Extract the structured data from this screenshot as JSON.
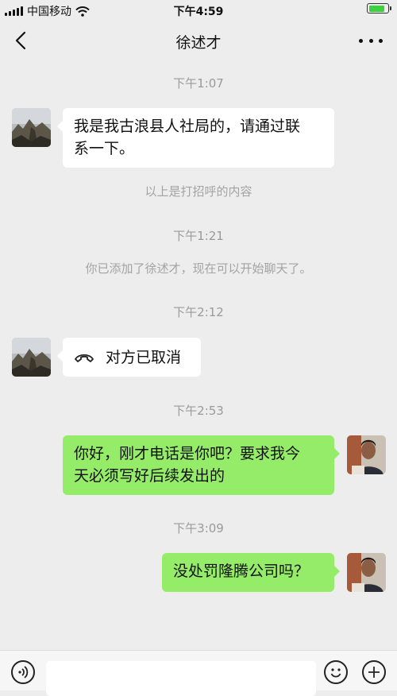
{
  "status_bar": {
    "carrier": "中国移动",
    "time": "下午4:59",
    "battery_level": 0.85
  },
  "header": {
    "title": "徐述才"
  },
  "messages": [
    {
      "time": "下午1:07"
    },
    {
      "from": "contact",
      "lines": [
        "我是我古浪县人社局的，请通过联",
        "系一下。"
      ]
    },
    {
      "system": "以上是打招呼的内容"
    },
    {
      "time": "下午1:21"
    },
    {
      "system": "你已添加了徐述才，现在可以开始聊天了。"
    },
    {
      "time": "下午2:12"
    },
    {
      "from": "contact",
      "call_status": "对方已取消",
      "icon": "phone-hangup-icon"
    },
    {
      "time": "下午2:53"
    },
    {
      "from": "me",
      "lines": [
        "你好，刚才电话是你吧？要求我今",
        "天必须写好后续发出的"
      ]
    },
    {
      "time": "下午3:09"
    },
    {
      "from": "me",
      "lines": [
        "没处罚隆腾公司吗？"
      ]
    }
  ],
  "colors": {
    "background": "#ededed",
    "incoming_bubble": "#ffffff",
    "outgoing_bubble": "#95ec69"
  },
  "input_bar": {
    "voice_icon": "voice-icon",
    "emoji_icon": "emoji-icon",
    "add_icon": "add-icon"
  }
}
